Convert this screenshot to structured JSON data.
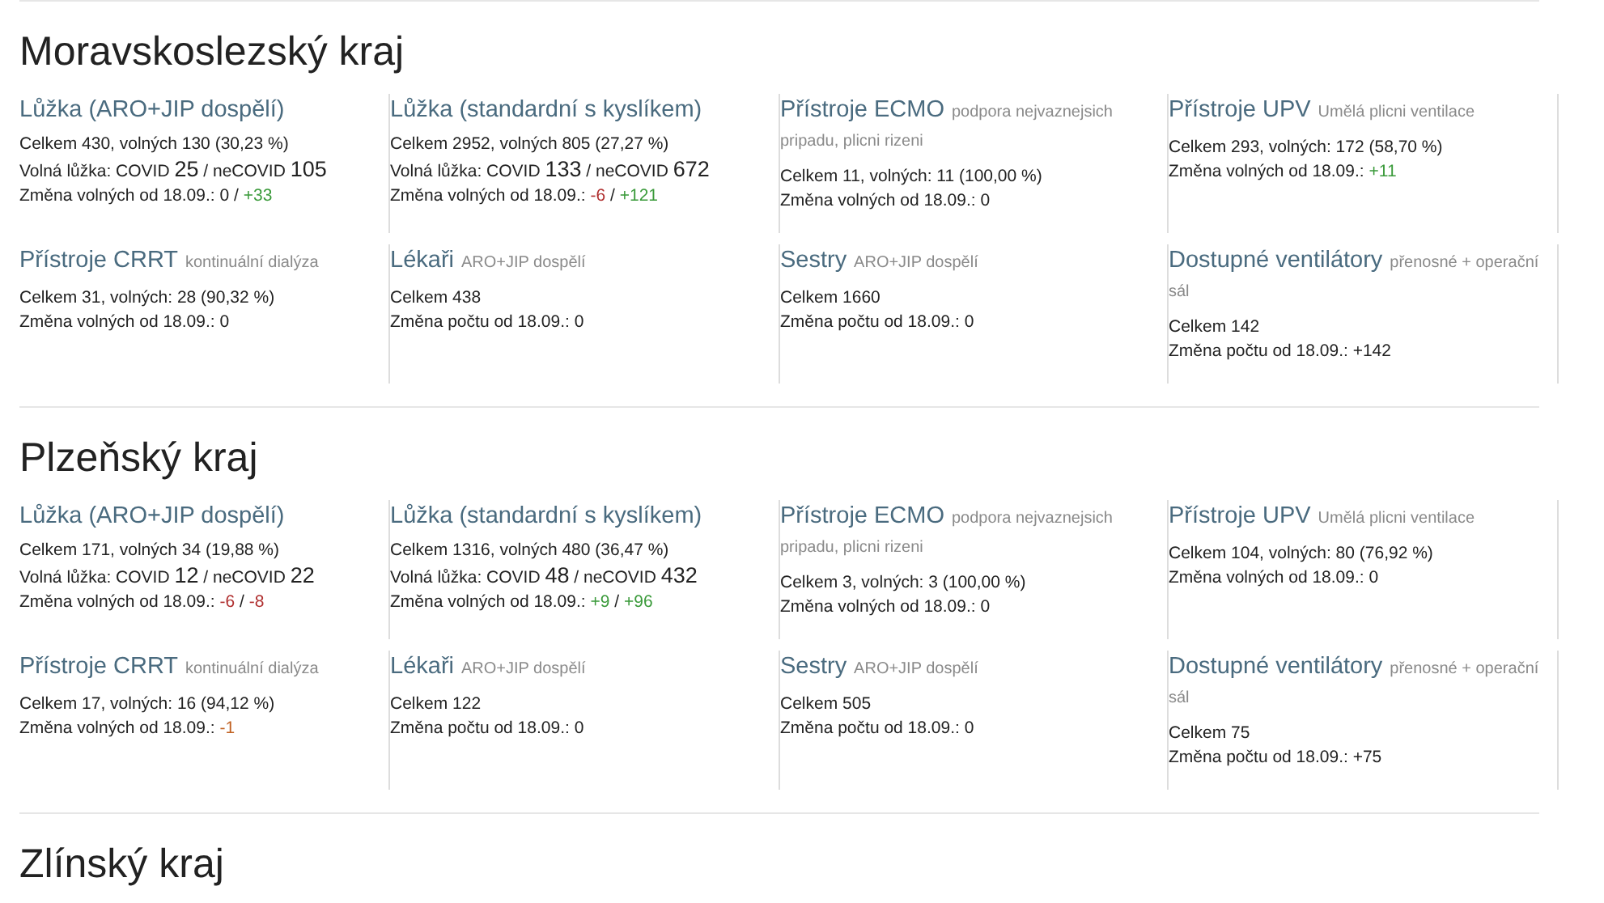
{
  "regions": [
    {
      "name": "Moravskoslezský kraj",
      "cards": [
        {
          "title": "Lůžka (ARO+JIP dospělí)",
          "lines": [
            [
              {
                "kind": "plain",
                "text": "Celkem 430, volných 130 (30,23 %)"
              }
            ],
            [
              {
                "kind": "plain",
                "text": "Volná lůžka: COVID "
              },
              {
                "kind": "big",
                "text": "25"
              },
              {
                "kind": "plain",
                "text": " / neCOVID "
              },
              {
                "kind": "big",
                "text": "105"
              }
            ],
            [
              {
                "kind": "plain",
                "text": "Změna volných od 18.09.: "
              },
              {
                "kind": "plain",
                "text": "0"
              },
              {
                "kind": "plain",
                "text": " / "
              },
              {
                "kind": "up",
                "text": "+33"
              }
            ]
          ]
        },
        {
          "title": "Lůžka (standardní s kyslíkem)",
          "lines": [
            [
              {
                "kind": "plain",
                "text": "Celkem 2952, volných 805 (27,27 %)"
              }
            ],
            [
              {
                "kind": "plain",
                "text": "Volná lůžka: COVID "
              },
              {
                "kind": "big",
                "text": "133"
              },
              {
                "kind": "plain",
                "text": " / neCOVID "
              },
              {
                "kind": "big",
                "text": "672"
              }
            ],
            [
              {
                "kind": "plain",
                "text": "Změna volných od 18.09.: "
              },
              {
                "kind": "down",
                "text": "-6"
              },
              {
                "kind": "plain",
                "text": " / "
              },
              {
                "kind": "up",
                "text": "+121"
              }
            ]
          ]
        },
        {
          "title": "Přístroje ECMO",
          "subtitle": "podpora nejvaznejsich pripadu, plicni rizeni",
          "lines": [
            [
              {
                "kind": "plain",
                "text": "Celkem 11, volných: 11 (100,00 %)"
              }
            ],
            [
              {
                "kind": "plain",
                "text": "Změna volných od 18.09.: "
              },
              {
                "kind": "plain",
                "text": "0"
              }
            ]
          ]
        },
        {
          "title": "Přístroje UPV",
          "subtitle": "Umělá plicni ventilace",
          "lines": [
            [
              {
                "kind": "plain",
                "text": "Celkem 293, volných: 172 (58,70 %)"
              }
            ],
            [
              {
                "kind": "plain",
                "text": "Změna volných od 18.09.: "
              },
              {
                "kind": "up",
                "text": "+11"
              }
            ]
          ]
        },
        {
          "title": "Přístroje CRRT",
          "subtitle": "kontinuální dialýza",
          "lines": [
            [
              {
                "kind": "plain",
                "text": "Celkem 31, volných: 28 (90,32 %)"
              }
            ],
            [
              {
                "kind": "plain",
                "text": "Změna volných od 18.09.: "
              },
              {
                "kind": "plain",
                "text": "0"
              }
            ]
          ]
        },
        {
          "title": "Lékaři",
          "subtitle": "ARO+JIP dospělí",
          "lines": [
            [
              {
                "kind": "plain",
                "text": "Celkem 438"
              }
            ],
            [
              {
                "kind": "plain",
                "text": "Změna počtu od 18.09.: "
              },
              {
                "kind": "plain",
                "text": "0"
              }
            ]
          ]
        },
        {
          "title": "Sestry",
          "subtitle": "ARO+JIP dospělí",
          "lines": [
            [
              {
                "kind": "plain",
                "text": "Celkem 1660"
              }
            ],
            [
              {
                "kind": "plain",
                "text": "Změna počtu od 18.09.: "
              },
              {
                "kind": "plain",
                "text": "0"
              }
            ]
          ]
        },
        {
          "title": "Dostupné ventilátory",
          "subtitle": "přenosné + operační sál",
          "lines": [
            [
              {
                "kind": "plain",
                "text": "Celkem 142"
              }
            ],
            [
              {
                "kind": "plain",
                "text": "Změna počtu od 18.09.: "
              },
              {
                "kind": "plain",
                "text": "+142"
              }
            ]
          ]
        }
      ]
    },
    {
      "name": "Plzeňský kraj",
      "cards": [
        {
          "title": "Lůžka (ARO+JIP dospělí)",
          "lines": [
            [
              {
                "kind": "plain",
                "text": "Celkem 171, volných 34 (19,88 %)"
              }
            ],
            [
              {
                "kind": "plain",
                "text": "Volná lůžka: COVID "
              },
              {
                "kind": "big",
                "text": "12"
              },
              {
                "kind": "plain",
                "text": " / neCOVID "
              },
              {
                "kind": "big",
                "text": "22"
              }
            ],
            [
              {
                "kind": "plain",
                "text": "Změna volných od 18.09.: "
              },
              {
                "kind": "down",
                "text": "-6"
              },
              {
                "kind": "plain",
                "text": " / "
              },
              {
                "kind": "down",
                "text": "-8"
              }
            ]
          ]
        },
        {
          "title": "Lůžka (standardní s kyslíkem)",
          "lines": [
            [
              {
                "kind": "plain",
                "text": "Celkem 1316, volných 480 (36,47 %)"
              }
            ],
            [
              {
                "kind": "plain",
                "text": "Volná lůžka: COVID "
              },
              {
                "kind": "big",
                "text": "48"
              },
              {
                "kind": "plain",
                "text": " / neCOVID "
              },
              {
                "kind": "big",
                "text": "432"
              }
            ],
            [
              {
                "kind": "plain",
                "text": "Změna volných od 18.09.: "
              },
              {
                "kind": "up",
                "text": "+9"
              },
              {
                "kind": "plain",
                "text": " / "
              },
              {
                "kind": "up",
                "text": "+96"
              }
            ]
          ]
        },
        {
          "title": "Přístroje ECMO",
          "subtitle": "podpora nejvaznejsich pripadu, plicni rizeni",
          "lines": [
            [
              {
                "kind": "plain",
                "text": "Celkem 3, volných: 3 (100,00 %)"
              }
            ],
            [
              {
                "kind": "plain",
                "text": "Změna volných od 18.09.: "
              },
              {
                "kind": "plain",
                "text": "0"
              }
            ]
          ]
        },
        {
          "title": "Přístroje UPV",
          "subtitle": "Umělá plicni ventilace",
          "lines": [
            [
              {
                "kind": "plain",
                "text": "Celkem 104, volných: 80 (76,92 %)"
              }
            ],
            [
              {
                "kind": "plain",
                "text": "Změna volných od 18.09.: "
              },
              {
                "kind": "plain",
                "text": "0"
              }
            ]
          ]
        },
        {
          "title": "Přístroje CRRT",
          "subtitle": "kontinuální dialýza",
          "lines": [
            [
              {
                "kind": "plain",
                "text": "Celkem 17, volných: 16 (94,12 %)"
              }
            ],
            [
              {
                "kind": "plain",
                "text": "Změna volných od 18.09.: "
              },
              {
                "kind": "warn",
                "text": "-1"
              }
            ]
          ]
        },
        {
          "title": "Lékaři",
          "subtitle": "ARO+JIP dospělí",
          "lines": [
            [
              {
                "kind": "plain",
                "text": "Celkem 122"
              }
            ],
            [
              {
                "kind": "plain",
                "text": "Změna počtu od 18.09.: "
              },
              {
                "kind": "plain",
                "text": "0"
              }
            ]
          ]
        },
        {
          "title": "Sestry",
          "subtitle": "ARO+JIP dospělí",
          "lines": [
            [
              {
                "kind": "plain",
                "text": "Celkem 505"
              }
            ],
            [
              {
                "kind": "plain",
                "text": "Změna počtu od 18.09.: "
              },
              {
                "kind": "plain",
                "text": "0"
              }
            ]
          ]
        },
        {
          "title": "Dostupné ventilátory",
          "subtitle": "přenosné + operační sál",
          "lines": [
            [
              {
                "kind": "plain",
                "text": "Celkem 75"
              }
            ],
            [
              {
                "kind": "plain",
                "text": "Změna počtu od 18.09.: "
              },
              {
                "kind": "plain",
                "text": "+75"
              }
            ]
          ]
        }
      ]
    },
    {
      "name": "Zlínský kraj"
    }
  ]
}
